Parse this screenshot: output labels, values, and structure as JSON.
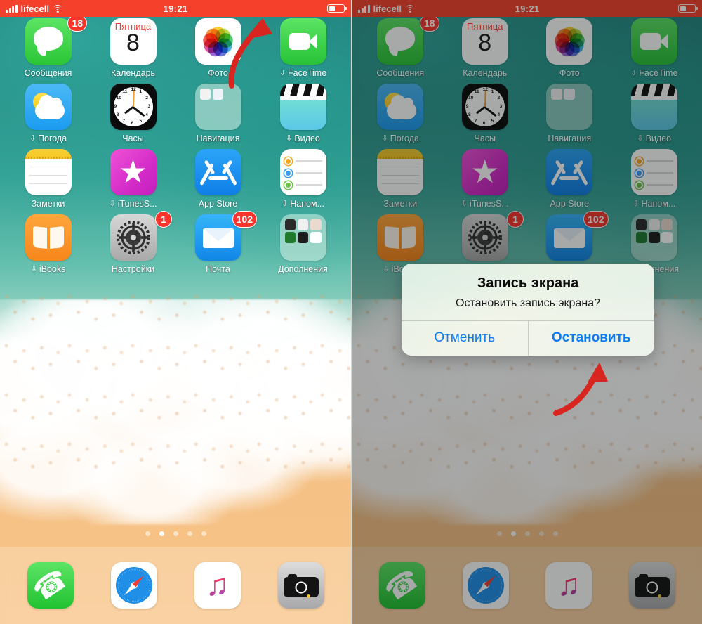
{
  "status_bar": {
    "carrier": "lifecell",
    "time": "19:21",
    "signal_icon": "signal-bars-icon",
    "wifi_icon": "wifi-icon",
    "battery_icon": "battery-icon",
    "recording_color": "#f5402c"
  },
  "home_screen": {
    "apps": [
      {
        "label": "Сообщения",
        "icon": "messages-icon",
        "badge": "18",
        "cloud": false
      },
      {
        "label": "Календарь",
        "icon": "calendar-icon",
        "badge": null,
        "cloud": false,
        "calendar": {
          "weekday": "Пятница",
          "day": "8"
        }
      },
      {
        "label": "Фото",
        "icon": "photos-icon",
        "badge": null,
        "cloud": false
      },
      {
        "label": "FaceTime",
        "icon": "facetime-icon",
        "badge": null,
        "cloud": true
      },
      {
        "label": "Погода",
        "icon": "weather-icon",
        "badge": null,
        "cloud": true
      },
      {
        "label": "Часы",
        "icon": "clock-icon",
        "badge": null,
        "cloud": false
      },
      {
        "label": "Навигация",
        "icon": "folder-icon",
        "badge": null,
        "cloud": false
      },
      {
        "label": "Видео",
        "icon": "videos-icon",
        "badge": null,
        "cloud": true
      },
      {
        "label": "Заметки",
        "icon": "notes-icon",
        "badge": null,
        "cloud": false
      },
      {
        "label": "iTunesS...",
        "icon": "itunes-store-icon",
        "badge": null,
        "cloud": true
      },
      {
        "label": "App Store",
        "icon": "app-store-icon",
        "badge": null,
        "cloud": false
      },
      {
        "label": "Напом...",
        "icon": "reminders-icon",
        "badge": null,
        "cloud": true
      },
      {
        "label": "iBooks",
        "icon": "ibooks-icon",
        "badge": null,
        "cloud": true
      },
      {
        "label": "Настройки",
        "icon": "settings-icon",
        "badge": "1",
        "cloud": false
      },
      {
        "label": "Почта",
        "icon": "mail-icon",
        "badge": "102",
        "cloud": false
      },
      {
        "label": "Дополнения",
        "icon": "folder-icon",
        "badge": null,
        "cloud": false
      }
    ],
    "cloud_glyph": "⇩",
    "page_dots": {
      "count": 5,
      "active_index": 1
    },
    "dock": [
      {
        "label": "Телефон",
        "icon": "phone-icon"
      },
      {
        "label": "Safari",
        "icon": "safari-icon"
      },
      {
        "label": "Музыка",
        "icon": "music-icon"
      },
      {
        "label": "Камера",
        "icon": "camera-icon"
      }
    ]
  },
  "alert": {
    "title": "Запись экрана",
    "message": "Остановить запись экрана?",
    "cancel_label": "Отменить",
    "stop_label": "Остановить",
    "accent_color": "#0b7cf0"
  },
  "annotations": {
    "arrow_color": "#d8251f",
    "arrow_left_target": "status-bar",
    "arrow_right_target": "stop-button"
  }
}
